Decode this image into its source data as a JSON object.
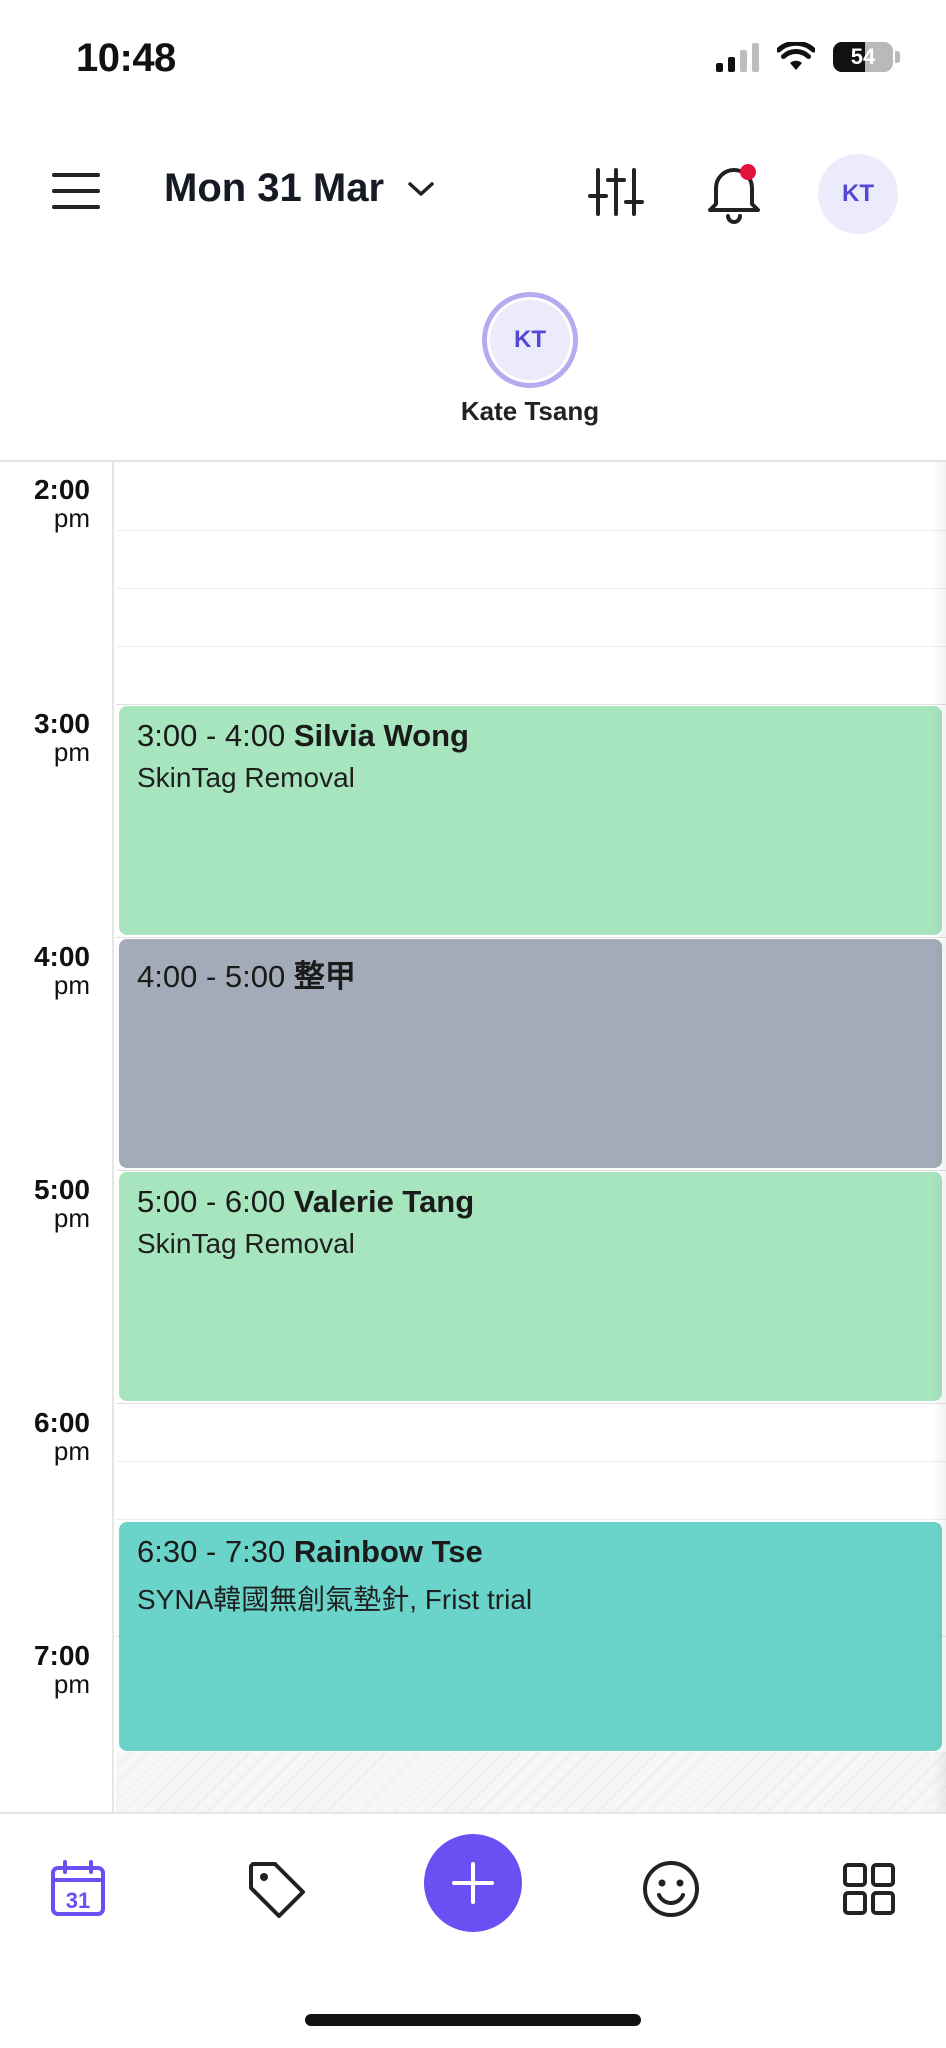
{
  "status_bar": {
    "time": "10:48",
    "battery_level": "54"
  },
  "header": {
    "date": "Mon 31 Mar",
    "avatar_initials": "KT",
    "has_notification": true
  },
  "staff": {
    "initials": "KT",
    "name": "Kate Tsang"
  },
  "calendar": {
    "time_labels": [
      {
        "hour": "2:00",
        "period": "pm"
      },
      {
        "hour": "3:00",
        "period": "pm"
      },
      {
        "hour": "4:00",
        "period": "pm"
      },
      {
        "hour": "5:00",
        "period": "pm"
      },
      {
        "hour": "6:00",
        "period": "pm"
      },
      {
        "hour": "7:00",
        "period": "pm"
      }
    ],
    "appointments": [
      {
        "time": "3:00 - 4:00",
        "client": "Silvia Wong",
        "service": "SkinTag Removal",
        "color": "#a6e5bd"
      },
      {
        "time": "4:00 - 5:00",
        "client": "整甲",
        "service": "",
        "color": "#a3abb8"
      },
      {
        "time": "5:00 - 6:00",
        "client": "Valerie Tang",
        "service": "SkinTag Removal",
        "color": "#a6e5bd"
      },
      {
        "time": "6:30 - 7:30",
        "client": "Rainbow Tse",
        "service": "SYNA韓國無創氣墊針, Frist trial",
        "color": "#6bd4ca"
      }
    ]
  },
  "bottom_nav": {
    "items": [
      "calendar-icon",
      "tag-icon",
      "add-icon",
      "smiley-icon",
      "grid-icon"
    ],
    "calendar_day": "31",
    "active": "calendar",
    "accent": "#6950f3"
  }
}
